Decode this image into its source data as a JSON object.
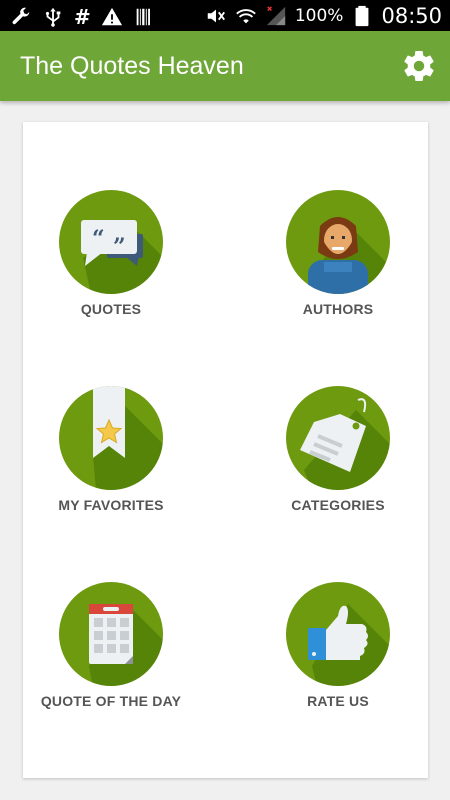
{
  "status_bar": {
    "battery_percent": "100%",
    "time": "08:50",
    "icons": [
      "wrench-icon",
      "usb-icon",
      "hash-icon",
      "warning-icon",
      "barcode-icon",
      "mute-icon",
      "wifi-icon",
      "signal-icon",
      "battery-icon"
    ]
  },
  "app_bar": {
    "title": "The Quotes Heaven",
    "settings_icon": "gear-icon"
  },
  "colors": {
    "app_bar": "#6fa638",
    "circle": "#6e9a0f",
    "label": "#555555"
  },
  "menu": [
    {
      "label": "QUOTES",
      "icon": "quote-bubbles-icon"
    },
    {
      "label": "AUTHORS",
      "icon": "author-avatar-icon"
    },
    {
      "label": "MY FAVORITES",
      "icon": "bookmark-star-icon"
    },
    {
      "label": "CATEGORIES",
      "icon": "tag-icon"
    },
    {
      "label": "QUOTE OF THE DAY",
      "icon": "calendar-icon"
    },
    {
      "label": "RATE US",
      "icon": "thumbs-up-icon"
    }
  ]
}
